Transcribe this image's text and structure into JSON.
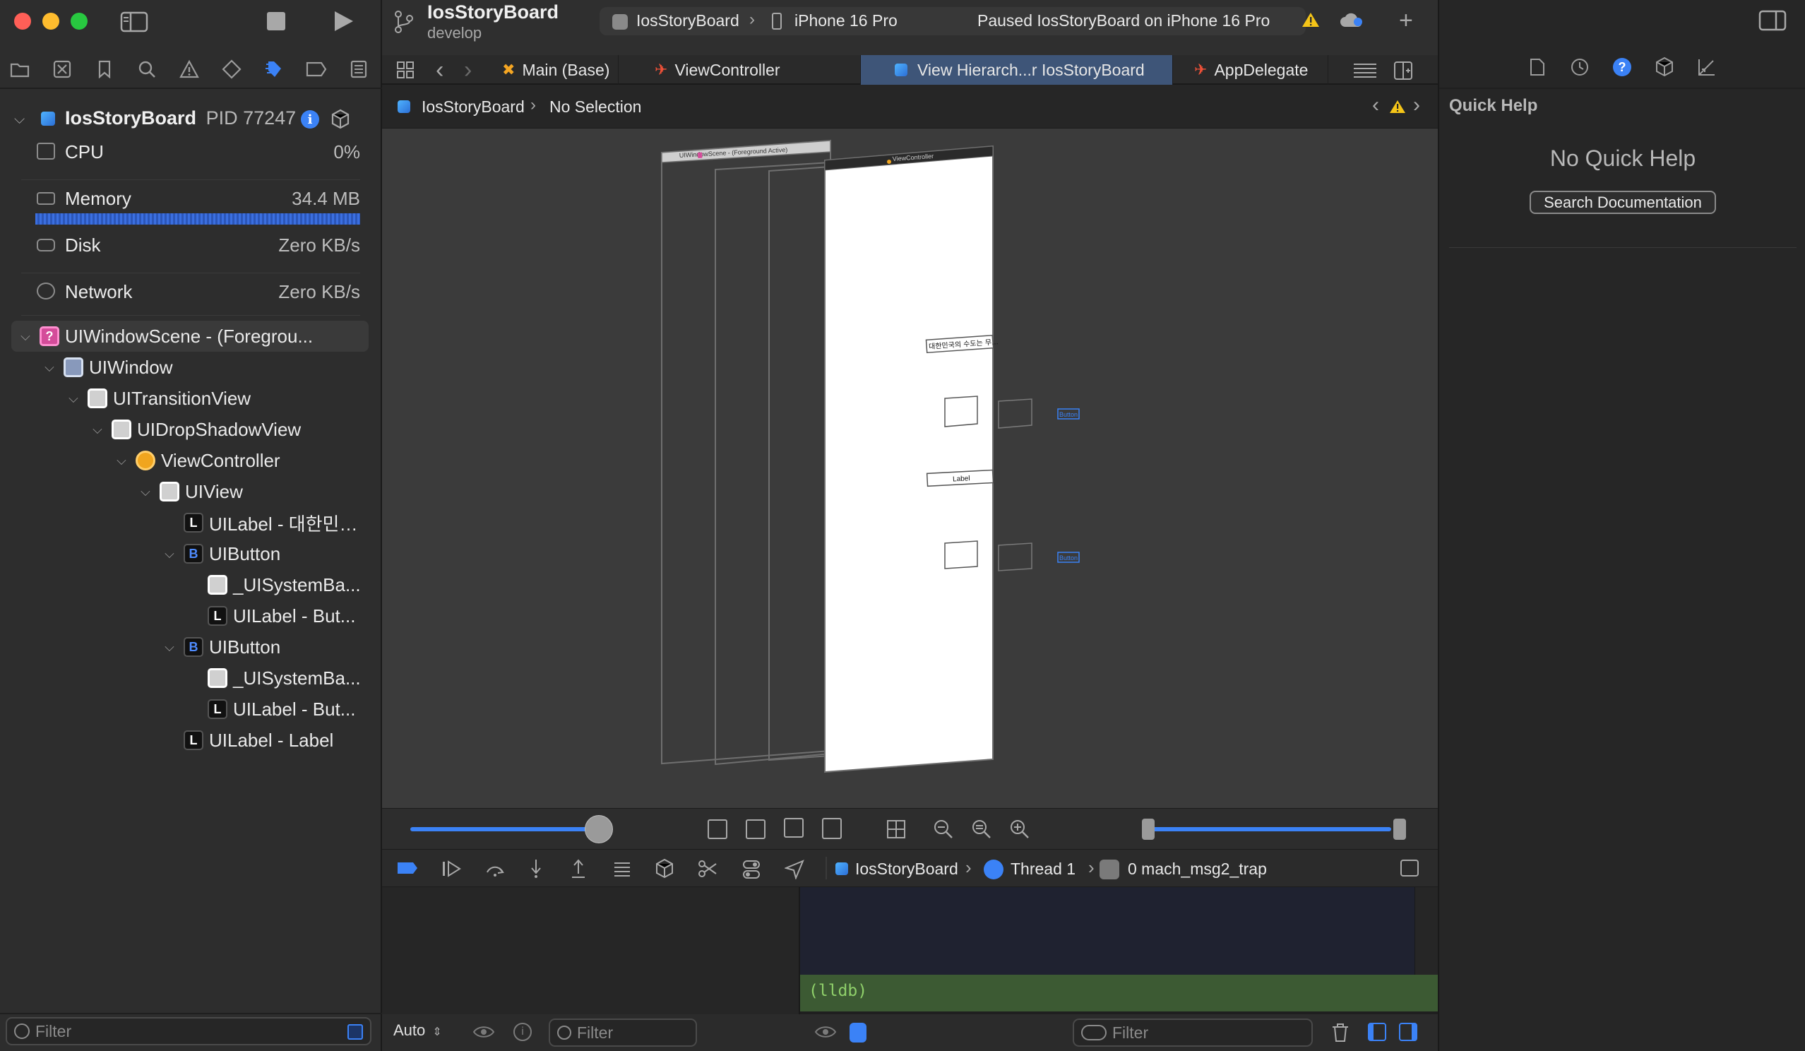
{
  "window": {
    "project_name": "IosStoryBoard",
    "branch": "develop",
    "scheme": "IosStoryBoard",
    "device": "iPhone 16 Pro",
    "status": "Paused IosStoryBoard on iPhone 16 Pro"
  },
  "tabs": [
    {
      "label": "Main (Base)",
      "icon": "xib-icon"
    },
    {
      "label": "ViewController",
      "icon": "swift-icon"
    },
    {
      "label": "View Hierarch...r IosStoryBoard",
      "icon": "hierarchy-icon",
      "active": true
    },
    {
      "label": "AppDelegate",
      "icon": "swift-icon"
    }
  ],
  "jumpbar": {
    "project": "IosStoryBoard",
    "selection": "No Selection"
  },
  "debug_navigator": {
    "process": "IosStoryBoard",
    "pid": "PID 77247",
    "gauges": [
      {
        "label": "CPU",
        "value": "0%"
      },
      {
        "label": "Memory",
        "value": "34.4 MB"
      },
      {
        "label": "Disk",
        "value": "Zero KB/s"
      },
      {
        "label": "Network",
        "value": "Zero KB/s"
      }
    ]
  },
  "tree": [
    {
      "label": "UIWindowScene - (Foregrou...",
      "depth": 0,
      "icon": "scene",
      "expanded": true,
      "selected": true
    },
    {
      "label": "UIWindow",
      "depth": 1,
      "icon": "window",
      "expanded": true
    },
    {
      "label": "UITransitionView",
      "depth": 2,
      "icon": "view",
      "expanded": true
    },
    {
      "label": "UIDropShadowView",
      "depth": 3,
      "icon": "view",
      "expanded": true
    },
    {
      "label": "ViewController",
      "depth": 4,
      "icon": "vc",
      "expanded": true
    },
    {
      "label": "UIView",
      "depth": 5,
      "icon": "view",
      "expanded": true
    },
    {
      "label": "UILabel - 대한민…",
      "depth": 6,
      "icon": "label"
    },
    {
      "label": "UIButton",
      "depth": 6,
      "icon": "button",
      "expanded": true
    },
    {
      "label": "_UISystemBa...",
      "depth": 7,
      "icon": "view"
    },
    {
      "label": "UILabel - But...",
      "depth": 7,
      "icon": "label"
    },
    {
      "label": "UIButton",
      "depth": 6,
      "icon": "button",
      "expanded": true
    },
    {
      "label": "_UISystemBa...",
      "depth": 7,
      "icon": "view"
    },
    {
      "label": "UILabel - But...",
      "depth": 7,
      "icon": "label"
    },
    {
      "label": "UILabel - Label",
      "depth": 6,
      "icon": "label"
    }
  ],
  "canvas": {
    "scene_title": "UIWindowScene - (Foreground Active)",
    "vc_title": "ViewController",
    "korean_label": "대한민국의 수도는 무...",
    "label_text": "Label",
    "button_text": "Button"
  },
  "debug_bar": {
    "target": "IosStoryBoard",
    "thread": "Thread 1",
    "frame": "0 mach_msg2_trap"
  },
  "console": {
    "prompt": "(lldb)"
  },
  "bottom": {
    "filter_placeholder": "Filter",
    "auto_label": "Auto"
  },
  "inspector": {
    "title": "Quick Help",
    "empty_text": "No Quick Help",
    "search_button": "Search Documentation"
  },
  "colors": {
    "accent": "#3b82f6",
    "active_tab": "#3e5578",
    "console_prompt_bg": "#3c5a33",
    "warning": "#f5c518"
  }
}
